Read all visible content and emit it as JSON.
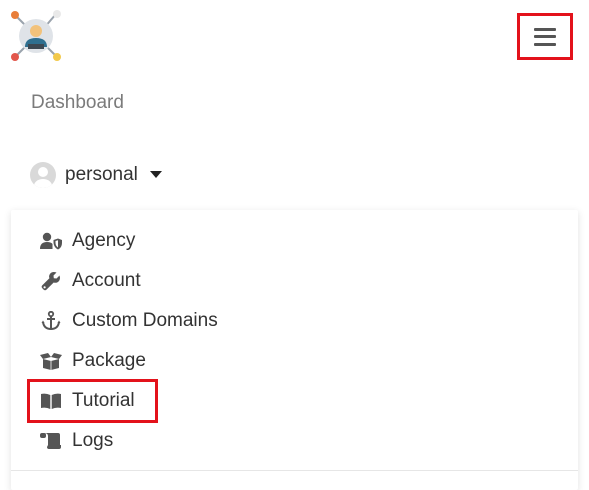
{
  "header": {
    "logo_icon": "people-network-logo-icon",
    "menu_icon": "hamburger-menu-icon"
  },
  "nav": {
    "dashboard_label": "Dashboard"
  },
  "user": {
    "name": "personal",
    "avatar_icon": "user-avatar-icon",
    "caret_icon": "caret-down-icon"
  },
  "dropdown": {
    "items": [
      {
        "label": "Agency",
        "icon": "user-shield-icon"
      },
      {
        "label": "Account",
        "icon": "wrench-icon"
      },
      {
        "label": "Custom Domains",
        "icon": "anchor-icon"
      },
      {
        "label": "Package",
        "icon": "box-open-icon"
      },
      {
        "label": "Tutorial",
        "icon": "book-open-icon"
      },
      {
        "label": "Logs",
        "icon": "scroll-icon"
      }
    ]
  },
  "colors": {
    "highlight": "#e3121b",
    "text": "#333333",
    "muted": "#7b7b7b"
  }
}
